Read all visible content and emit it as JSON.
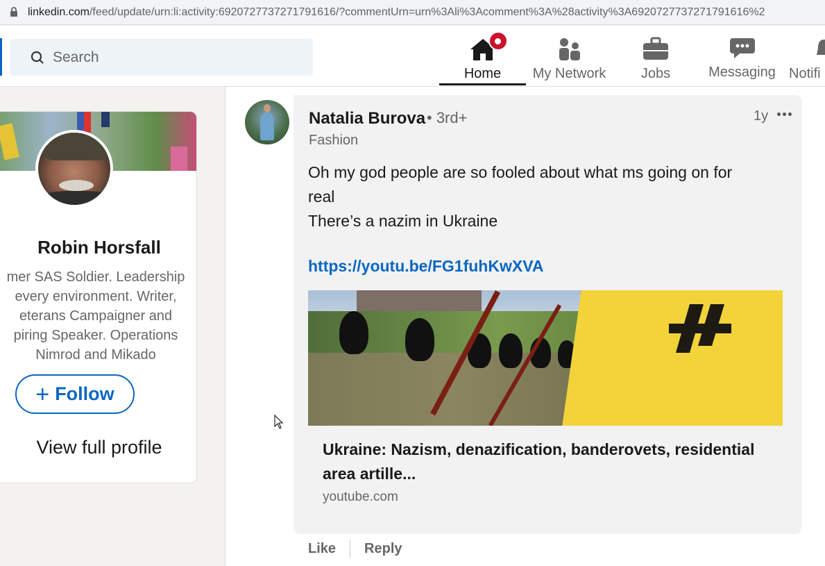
{
  "browser": {
    "url_host": "linkedin.com",
    "url_rest": "/feed/update/urn:li:activity:6920727737271791616/?commentUrn=urn%3Ali%3Acomment%3A%28activity%3A6920727737271791616%2",
    "lock_icon": "lock-icon"
  },
  "nav": {
    "search_placeholder": "Search",
    "items": [
      {
        "label": "Home",
        "icon": "home-icon",
        "active": true
      },
      {
        "label": "My Network",
        "icon": "people-icon"
      },
      {
        "label": "Jobs",
        "icon": "briefcase-icon"
      },
      {
        "label": "Messaging",
        "icon": "chat-icon"
      },
      {
        "label": "Notifi",
        "icon": "bell-icon"
      }
    ]
  },
  "profile": {
    "name": "Robin Horsfall",
    "bio_lines": [
      "mer SAS Soldier. Leadership",
      "every environment. Writer,",
      "eterans Campaigner and",
      "piring Speaker. Operations",
      "Nimrod and Mikado"
    ],
    "follow_label": "Follow",
    "view_profile_label": "View full profile"
  },
  "comment": {
    "author": "Natalia Burova",
    "degree": "• 3rd+",
    "headline": "Fashion",
    "time": "1y",
    "text_lines": [
      "Oh my god people are so fooled about what ms going on for",
      "real",
      "There’s a nazim in Ukraine"
    ],
    "link": "https://youtu.be/FG1fuhKwXVA",
    "preview_title_lines": [
      "Ukraine: Nazism, denazification, banderovets, residential",
      "area artille..."
    ],
    "preview_source": "youtube.com",
    "actions": {
      "like": "Like",
      "reply": "Reply"
    }
  },
  "colors": {
    "linkedin_blue": "#0a66c2",
    "badge_red": "#cb112d",
    "page_bg": "#f3f2ef"
  }
}
